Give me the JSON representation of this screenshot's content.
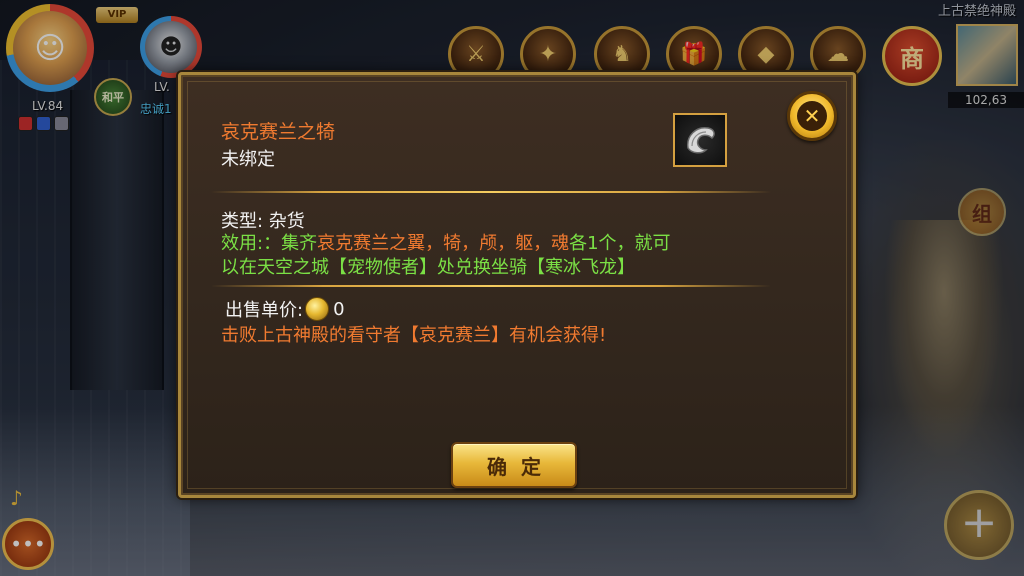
{
  "hud": {
    "vip_label": "VIP",
    "player_level": "LV.84",
    "pet_level": "LV.",
    "peace_label": "和平",
    "loyalty_text": "忠诚1",
    "location_name": "上古禁绝神殿",
    "coordinates": "102,63",
    "shop_label": "商",
    "group_label": "组",
    "top_icons": [
      "weapon-icon",
      "exp-icon",
      "lion-icon",
      "gift-box-icon",
      "gold-ingot-icon",
      "mount-icon"
    ]
  },
  "dialog": {
    "item_name": "哀克赛兰之犄",
    "bind_status": "未绑定",
    "type_label": "类型",
    "type_value": "杂货",
    "effect_label": "效用:",
    "effect_part1": "：集齐",
    "effect_highlight": "哀克赛兰之翼，犄，颅，躯，魂",
    "effect_part2": "各1个，就可",
    "effect_line2": "以在天空之城【宠物使者】处兑换坐骑【寒冰飞龙】",
    "price_label": "出售单价:",
    "price_value": "0",
    "source_text": "击败上古神殿的看守者【哀克赛兰】有机会获得!",
    "ok_label": "确定",
    "item_icon": "horn-icon",
    "close_icon": "close-icon"
  },
  "colors": {
    "title_orange": "#f07a30",
    "effect_green": "#7be045",
    "frame_gold": "#a8873c"
  }
}
